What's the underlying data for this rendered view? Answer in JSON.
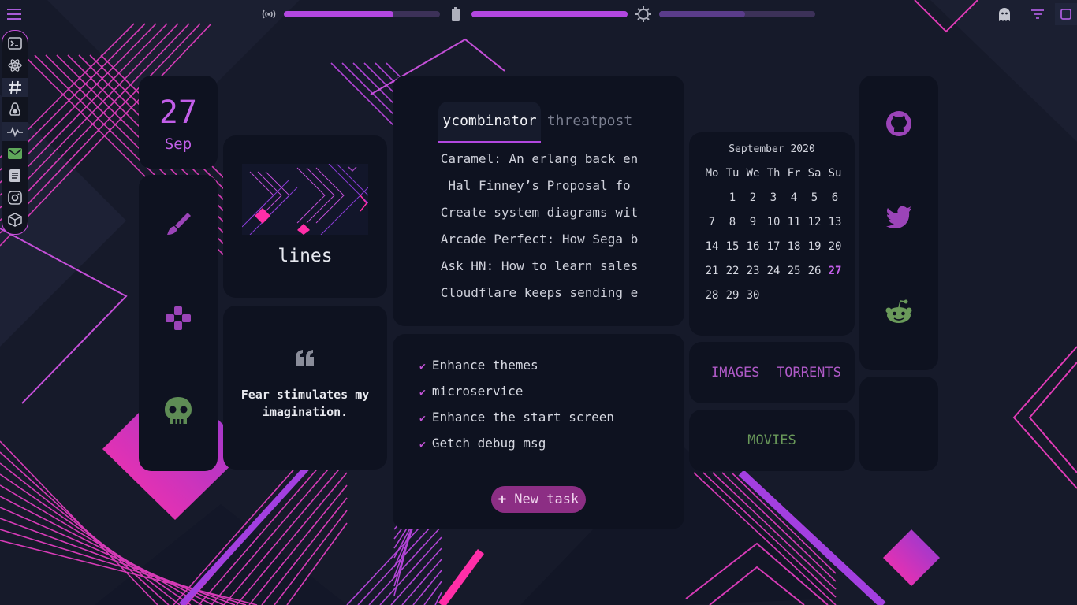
{
  "topbar": {
    "wifi_level": 0.7,
    "battery_level": 1.0,
    "brightness_level": 0.55
  },
  "icons": {
    "menu": "hamburger-icon",
    "wifi": "wifi-icon",
    "battery": "battery-icon",
    "brightness": "brightness-icon",
    "ghost": "ghost-icon",
    "filter": "filter-icon",
    "square": "square-icon"
  },
  "dock": {
    "items": [
      {
        "icon": "terminal-icon"
      },
      {
        "icon": "atom-icon"
      },
      {
        "icon": "hashtag-icon"
      },
      {
        "icon": "linux-icon"
      },
      {
        "icon": "pulse-icon"
      },
      {
        "icon": "mail-icon"
      },
      {
        "icon": "document-icon"
      },
      {
        "icon": "instagram-icon"
      },
      {
        "icon": "cube-icon"
      }
    ]
  },
  "date": {
    "day": "27",
    "month": "Sep"
  },
  "apps": [
    {
      "icon": "brush-icon"
    },
    {
      "icon": "gamepad-icon"
    },
    {
      "icon": "skull-icon"
    }
  ],
  "theme": {
    "name": "lines"
  },
  "quote": {
    "text": "Fear stimulates my imagination."
  },
  "news": {
    "tabs": [
      {
        "label": "ycombinator",
        "active": true
      },
      {
        "label": "threatpost",
        "active": false
      }
    ],
    "items": [
      "Caramel: An erlang back en",
      "Hal Finney’s Proposal fo",
      "Create system diagrams wit",
      "Arcade Perfect: How Sega b",
      "Ask HN: How to learn sales",
      "Cloudflare keeps sending e"
    ]
  },
  "todo": {
    "items": [
      "Enhance themes",
      "microservice",
      "Enhance the start screen",
      "Getch debug msg"
    ],
    "new_task_label": "New task"
  },
  "calendar": {
    "title": "September 2020",
    "weekdays": [
      "Mo",
      "Tu",
      "We",
      "Th",
      "Fr",
      "Sa",
      "Su"
    ],
    "weeks": [
      [
        "",
        "1",
        "2",
        "3",
        "4",
        "5",
        "6"
      ],
      [
        "7",
        "8",
        "9",
        "10",
        "11",
        "12",
        "13"
      ],
      [
        "14",
        "15",
        "16",
        "17",
        "18",
        "19",
        "20"
      ],
      [
        "21",
        "22",
        "23",
        "24",
        "25",
        "26",
        "27"
      ],
      [
        "28",
        "29",
        "30",
        "",
        "",
        "",
        ""
      ]
    ],
    "today": "27"
  },
  "links": {
    "images": "IMAGES",
    "torrents": "TORRENTS",
    "movies": "MOVIES"
  },
  "social": [
    {
      "icon": "github-icon"
    },
    {
      "icon": "twitter-icon"
    },
    {
      "icon": "reddit-icon"
    }
  ],
  "colors": {
    "accent": "#b247e0",
    "pink": "#ff2ea8",
    "background": "#161a2a",
    "card": "#0e1220",
    "green": "#6a9a5a"
  }
}
